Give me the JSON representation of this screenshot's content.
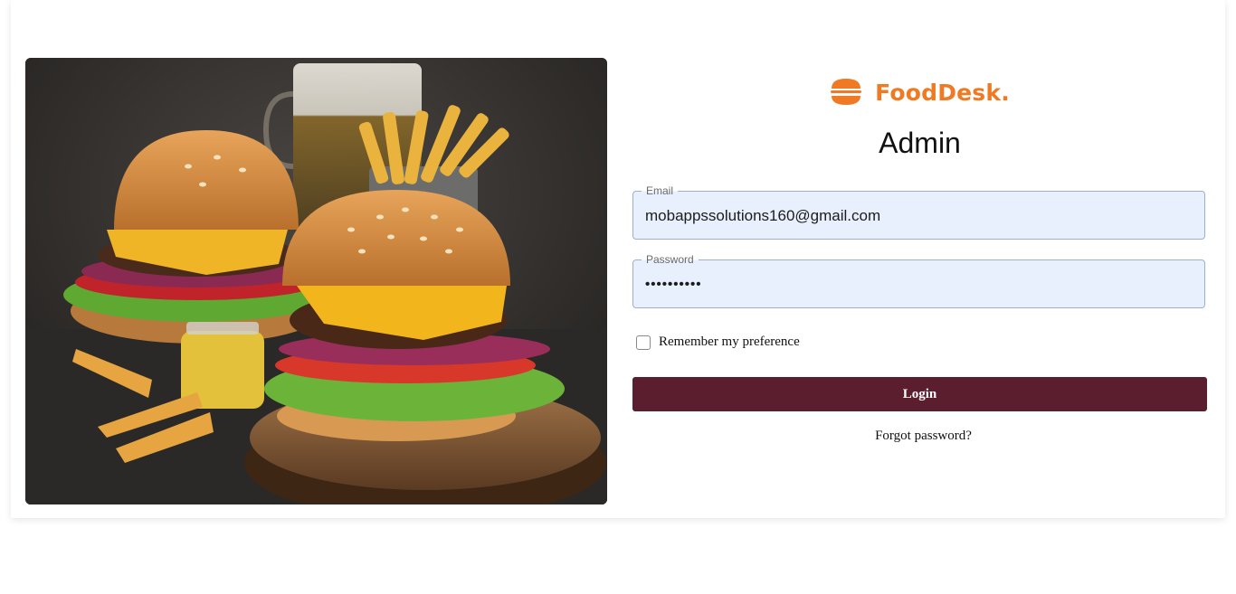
{
  "brand": {
    "name": "FoodDesk.",
    "color": "#f07a23"
  },
  "page": {
    "title": "Admin"
  },
  "form": {
    "email": {
      "label": "Email",
      "value": "mobappssolutions160@gmail.com"
    },
    "password": {
      "label": "Password",
      "value": "••••••••••"
    },
    "remember": {
      "label": "Remember my preference",
      "checked": false
    },
    "login_label": "Login",
    "forgot_label": "Forgot password?"
  },
  "hero": {
    "image": "burgers-and-fries-photo"
  },
  "colors": {
    "input_bg": "#e8f0fe",
    "button_bg": "#5a1e2f"
  }
}
